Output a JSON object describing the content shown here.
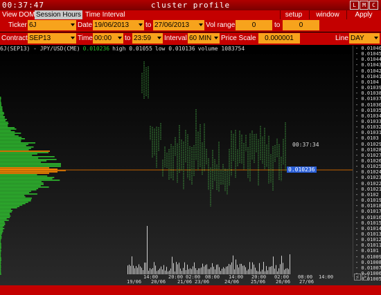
{
  "window": {
    "clock": "00:37:47",
    "title": "cluster profile",
    "buttons": [
      "L",
      "M",
      "C"
    ]
  },
  "menu": {
    "left": [
      "View DOM",
      "Session Hours",
      "Time Interval"
    ],
    "right": [
      "setup",
      "window",
      "Apply"
    ]
  },
  "row1": {
    "ticker_label": "Ticker",
    "ticker_value": "6J",
    "date_label": "Date",
    "date_from": "19/06/2013",
    "to_label": "to",
    "date_to": "27/06/2013",
    "vol_label": "Vol range",
    "vol_from": "0",
    "vol_to_label": "to",
    "vol_to": "0"
  },
  "row2": {
    "contract_label": "Contract",
    "contract_value": "SEP13",
    "time_label": "Time",
    "time_from": "00:00",
    "time_to_label": "to",
    "time_to": "23:59",
    "interval_label": "Interval",
    "interval_value": "60 MIN",
    "price_scale_label": "Price Scale",
    "price_scale_value": "0.000001",
    "line_label": "Line",
    "line_value": "DAY"
  },
  "info": {
    "symbol": "6J(SEP13) - JPY/USD(CME)",
    "last": "0.010236",
    "high": "high 0.01055",
    "low": "low 0.010136",
    "volume": "volume 1083754"
  },
  "price_tag": "0.010236",
  "timer": "00:37:34",
  "price_axis": [
    "0.01046",
    "0.01045",
    "0.01044",
    "0.01043",
    "0.01042",
    "0.01041",
    "0.0104",
    "0.01039",
    "0.01038",
    "0.01037",
    "0.01036",
    "0.01035",
    "0.01034",
    "0.01033",
    "0.01032",
    "0.01031",
    "0.0103",
    "0.01029",
    "0.01028",
    "0.01027",
    "0.01026",
    "0.01025",
    "0.01024",
    "0.01023",
    "0.01022",
    "0.01021",
    "0.0102",
    "0.01019",
    "0.01018",
    "0.01017",
    "0.01016",
    "0.01015",
    "0.01014",
    "0.01013",
    "0.01012",
    "0.01011",
    "0.0101",
    "0.01009",
    "0.01008",
    "0.01007",
    "0.01006",
    "0.01005"
  ],
  "time_axis": {
    "top": [
      "14:00",
      "20:00",
      "02:00",
      "08:00",
      "14:00",
      "20:00",
      "02:00",
      "08:00",
      "14:00"
    ],
    "bottom": [
      "19/06",
      "20/06",
      "21/06",
      "23/06",
      "24/06",
      "25/06",
      "26/06",
      "27/06"
    ]
  },
  "nav": [
    "<",
    ">"
  ],
  "colors": {
    "accent_red": "#c40000",
    "field_orange": "#f7a31c",
    "profile_green": "#2fbf2f",
    "poc_orange": "#ff8c00",
    "price_line": "#c86400",
    "tag_blue": "#2a5fd8"
  }
}
